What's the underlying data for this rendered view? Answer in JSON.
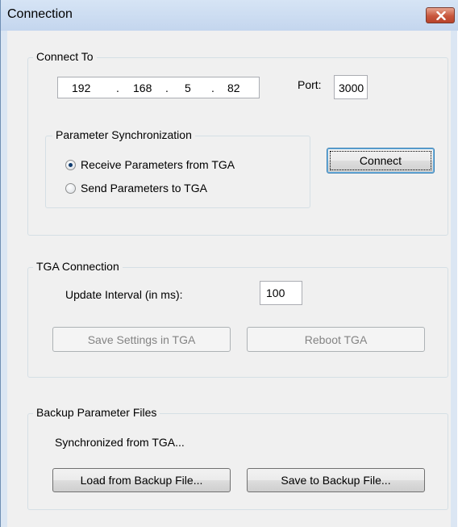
{
  "window": {
    "title": "Connection",
    "close_icon": "close-icon"
  },
  "connect_to": {
    "legend": "Connect To",
    "ip": [
      "192",
      "168",
      "5",
      "82"
    ],
    "ip_separator": ".",
    "port_label": "Port:",
    "port_value": "3000",
    "param_sync": {
      "legend": "Parameter Synchronization",
      "options": [
        {
          "label": "Receive Parameters from TGA",
          "checked": true
        },
        {
          "label": "Send Parameters to TGA",
          "checked": false
        }
      ]
    },
    "connect_button": "Connect"
  },
  "tga_connection": {
    "legend": "TGA Connection",
    "update_interval_label": "Update Interval (in ms):",
    "update_interval_value": "100",
    "save_settings_button": "Save Settings in TGA",
    "reboot_button": "Reboot TGA"
  },
  "backup": {
    "legend": "Backup Parameter Files",
    "status_text": "Synchronized from TGA...",
    "load_button": "Load from Backup File...",
    "save_button": "Save to Backup File..."
  },
  "colors": {
    "title_bar": "#c9daf0",
    "close_button": "#c8573d",
    "dialog_background": "#f0f0f0",
    "radio_checked_dot": "#0f3b6e"
  }
}
